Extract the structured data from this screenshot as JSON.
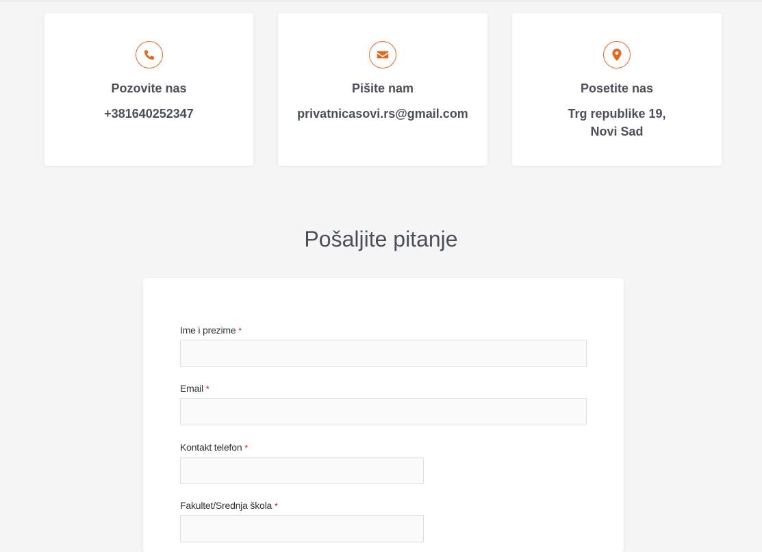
{
  "contact_cards": [
    {
      "icon": "phone-icon",
      "title": "Pozovite nas",
      "lines": [
        "+381640252347"
      ]
    },
    {
      "icon": "envelope-icon",
      "title": "Pišite nam",
      "lines": [
        "privatnicasovi.rs@gmail.com"
      ]
    },
    {
      "icon": "map-marker-icon",
      "title": "Posetite nas",
      "lines": [
        "Trg republike 19,",
        "Novi Sad"
      ]
    }
  ],
  "form": {
    "title": "Pošaljite pitanje",
    "required_marker": "*",
    "fields": [
      {
        "label": "Ime i prezime",
        "value": "",
        "required": true
      },
      {
        "label": "Email",
        "value": "",
        "required": true
      },
      {
        "label": "Kontakt telefon",
        "value": "",
        "required": true
      },
      {
        "label": "Fakultet/Srednja škola",
        "value": "",
        "required": true
      }
    ]
  },
  "colors": {
    "accent": "#e8651e",
    "background": "#f5f5f5",
    "card": "#ffffff",
    "text": "#4b4f58",
    "input_bg": "#fafafa",
    "required": "#e00000"
  }
}
